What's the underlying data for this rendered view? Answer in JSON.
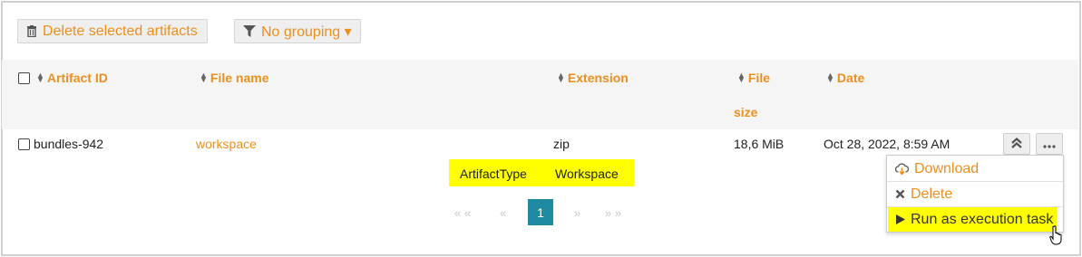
{
  "toolbar": {
    "delete_label": "Delete selected artifacts",
    "grouping_label": "No grouping ▾"
  },
  "table": {
    "columns": {
      "artifact_id": "Artifact ID",
      "file_name": "File name",
      "extension": "Extension",
      "file": "File",
      "size": "size",
      "date": "Date"
    },
    "rows": [
      {
        "artifact_id": "bundles-942",
        "file_name": "workspace",
        "extension": "zip",
        "file_size": "18,6 MiB",
        "date": "Oct 28, 2022, 8:59 AM",
        "tag_key": "ArtifactType",
        "tag_value": "Workspace"
      }
    ]
  },
  "pagination": {
    "first": "« «",
    "prev": "«",
    "current": "1",
    "next": "»",
    "last": "» »"
  },
  "menu": {
    "download": "Download",
    "delete": "Delete",
    "run": "Run as execution task"
  },
  "colors": {
    "accent": "#ee8f1c",
    "highlight": "#ffff00",
    "page_active": "#1f8ba3"
  }
}
